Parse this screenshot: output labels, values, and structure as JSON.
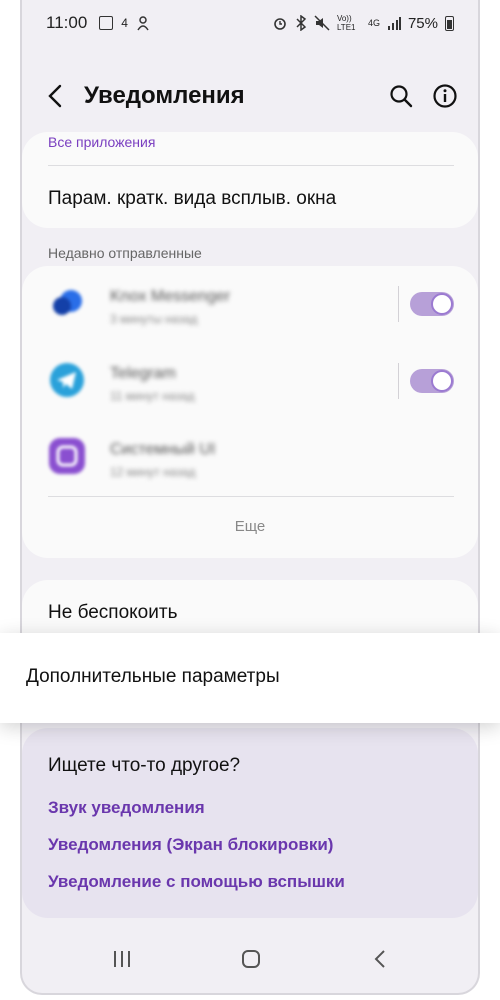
{
  "status_bar": {
    "time": "11:00",
    "network_4": "4",
    "volte": "Vo)) LTE1",
    "network_4g": "4G",
    "battery": "75%"
  },
  "header": {
    "title": "Уведомления",
    "back_icon": "chevron-left-icon",
    "search_icon": "search-icon",
    "info_icon": "info-icon"
  },
  "card1": {
    "all_apps_label": "Все приложения",
    "popup_setting_label": "Парам. кратк. вида всплыв. окна"
  },
  "recent": {
    "section_label": "Недавно отправленные",
    "apps": [
      {
        "name": "Knox Messenger",
        "time": "3 минуты назад",
        "toggle_on": true,
        "icon_color": "#2a6ee8"
      },
      {
        "name": "Telegram",
        "time": "11 минут назад",
        "toggle_on": true,
        "icon_color": "#2aa1da"
      },
      {
        "name": "Системный UI",
        "time": "12 минут назад",
        "toggle_on": null,
        "icon_color": "#8a4fd0"
      }
    ],
    "more_label": "Еще"
  },
  "dnd": {
    "label": "Не беспокоить"
  },
  "popup": {
    "label": "Дополнительные параметры"
  },
  "looking": {
    "title": "Ищете что-то другое?",
    "links": [
      "Звук уведомления",
      "Уведомления (Экран блокировки)",
      "Уведомление с помощью вспышки"
    ]
  },
  "colors": {
    "accent": "#7a3fc0",
    "toggle": "#b7a0d8",
    "background": "#f1eff4"
  }
}
